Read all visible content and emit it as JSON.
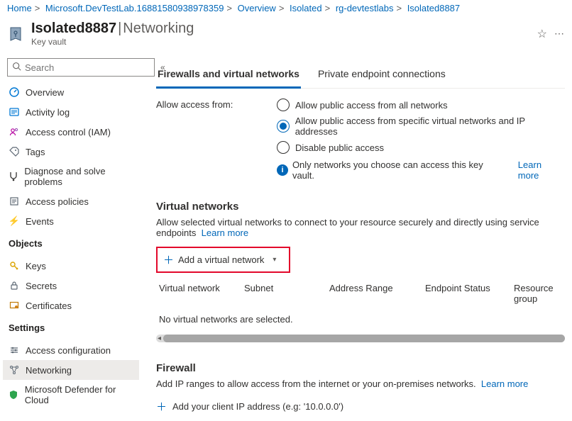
{
  "breadcrumb": [
    "Home",
    "Microsoft.DevTestLab.16881580938978359",
    "Overview",
    "Isolated",
    "rg-devtestlabs",
    "Isolated8887"
  ],
  "title": {
    "name": "Isolated8887",
    "page": "Networking",
    "sub": "Key vault"
  },
  "search": {
    "placeholder": "Search"
  },
  "nav": {
    "top": [
      "Overview",
      "Activity log",
      "Access control (IAM)",
      "Tags",
      "Diagnose and solve problems",
      "Access policies",
      "Events"
    ],
    "objects_h": "Objects",
    "objects": [
      "Keys",
      "Secrets",
      "Certificates"
    ],
    "settings_h": "Settings",
    "settings": [
      "Access configuration",
      "Networking",
      "Microsoft Defender for Cloud"
    ],
    "active": "Networking"
  },
  "tabs": {
    "a": "Firewalls and virtual networks",
    "b": "Private endpoint connections"
  },
  "access": {
    "label": "Allow access from:",
    "opt1": "Allow public access from all networks",
    "opt2": "Allow public access from specific virtual networks and IP addresses",
    "opt3": "Disable public access",
    "info": "Only networks you choose can access this key vault.",
    "learn": "Learn more"
  },
  "vnet": {
    "h": "Virtual networks",
    "desc": "Allow selected virtual networks to connect to your resource securely and directly using service endpoints",
    "learn": "Learn more",
    "add": "Add a virtual network",
    "cols": {
      "c1": "Virtual network",
      "c2": "Subnet",
      "c3": "Address Range",
      "c4": "Endpoint Status",
      "c5": "Resource group"
    },
    "empty": "No virtual networks are selected."
  },
  "fw": {
    "h": "Firewall",
    "desc": "Add IP ranges to allow access from the internet or your on-premises networks.",
    "learn": "Learn more",
    "add": "Add your client IP address (e.g: '10.0.0.0')"
  }
}
